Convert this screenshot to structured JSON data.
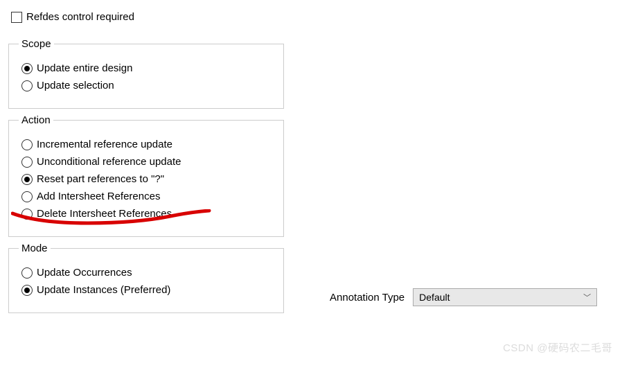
{
  "checkbox": {
    "label": "Refdes control required"
  },
  "scope": {
    "legend": "Scope",
    "options": [
      {
        "label": "Update entire design",
        "selected": true
      },
      {
        "label": "Update selection",
        "selected": false
      }
    ]
  },
  "action": {
    "legend": "Action",
    "options": [
      {
        "label": "Incremental reference update",
        "selected": false
      },
      {
        "label": "Unconditional reference update",
        "selected": false
      },
      {
        "label": "Reset part references to \"?\"",
        "selected": true
      },
      {
        "label": "Add Intersheet References",
        "selected": false
      },
      {
        "label": "Delete Intersheet References",
        "selected": false
      }
    ]
  },
  "mode": {
    "legend": "Mode",
    "options": [
      {
        "label": "Update Occurrences",
        "selected": false
      },
      {
        "label": "Update Instances (Preferred)",
        "selected": true
      }
    ]
  },
  "annotation": {
    "label": "Annotation Type",
    "value": "Default"
  },
  "watermark": "CSDN @硬码农二毛哥"
}
